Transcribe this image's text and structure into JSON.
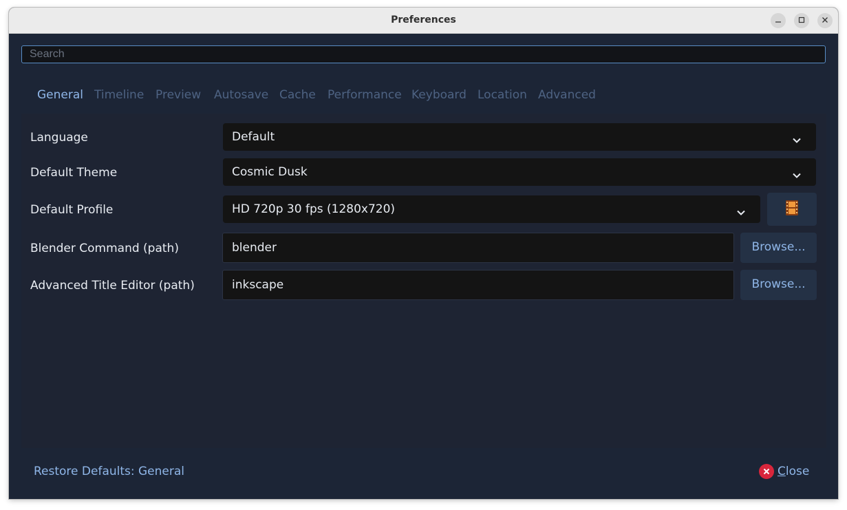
{
  "window": {
    "title": "Preferences",
    "controls": {
      "minimize": "minimize-icon",
      "maximize": "maximize-icon",
      "close": "close-icon"
    }
  },
  "search": {
    "placeholder": "Search",
    "value": ""
  },
  "tabs": [
    {
      "label": "General",
      "active": true
    },
    {
      "label": "Timeline",
      "active": false
    },
    {
      "label": "Preview",
      "active": false
    },
    {
      "label": "Autosave",
      "active": false
    },
    {
      "label": "Cache",
      "active": false
    },
    {
      "label": "Performance",
      "active": false
    },
    {
      "label": "Keyboard",
      "active": false
    },
    {
      "label": "Location",
      "active": false
    },
    {
      "label": "Advanced",
      "active": false
    }
  ],
  "settings": {
    "language": {
      "label": "Language",
      "value": "Default"
    },
    "theme": {
      "label": "Default Theme",
      "value": "Cosmic Dusk"
    },
    "profile": {
      "label": "Default Profile",
      "value": "HD 720p 30 fps (1280x720)",
      "button_icon": "film-strip-icon"
    },
    "blender": {
      "label": "Blender Command (path)",
      "value": "blender",
      "browse_label": "Browse..."
    },
    "title_editor": {
      "label": "Advanced Title Editor (path)",
      "value": "inkscape",
      "browse_label": "Browse..."
    }
  },
  "footer": {
    "restore_label": "Restore Defaults: General",
    "close_label_first": "C",
    "close_label_rest": "lose"
  },
  "colors": {
    "background": "#1c2536",
    "panel": "#1e2433",
    "accent": "#8fb6e8",
    "inactive_tab": "#4e6383",
    "close_red": "#d8263c"
  }
}
